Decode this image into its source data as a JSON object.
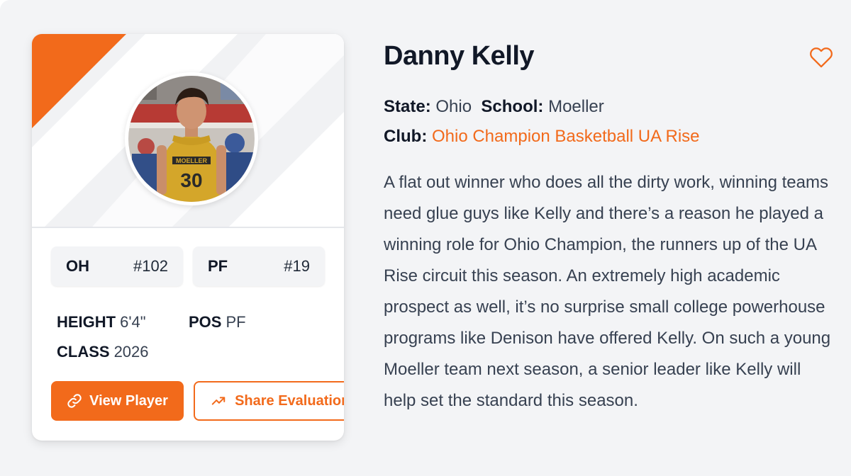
{
  "player": {
    "name": "Danny Kelly",
    "state_label": "State:",
    "state": "Ohio",
    "school_label": "School:",
    "school": "Moeller",
    "club_label": "Club:",
    "club": "Ohio Champion Basketball UA Rise",
    "description": "A flat out winner who does all the dirty work, winning teams need glue guys like Kelly and there’s a reason he played a winning role for Ohio Champion, the runners up of the UA Rise circuit this season. An extremely high academic prospect as well, it’s no surprise small college powerhouse programs like Denison have offered Kelly. On such a young Moeller team next season, a senior leader like Kelly will help set the standard this season."
  },
  "ranks": [
    {
      "key": "OH",
      "value": "#102"
    },
    {
      "key": "PF",
      "value": "#19"
    }
  ],
  "stats": {
    "height_label": "HEIGHT",
    "height": "6'4\"",
    "pos_label": "POS",
    "pos": "PF",
    "class_label": "CLASS",
    "class": "2026"
  },
  "jersey": {
    "team": "MOELLER",
    "number": "30"
  },
  "buttons": {
    "view_player": "View Player",
    "share_evaluation": "Share Evaluation"
  },
  "icons": {
    "favorite": "heart-icon",
    "view": "link-icon",
    "share": "trending-up-icon"
  },
  "colors": {
    "accent": "#f26a1b",
    "heading": "#111827",
    "text": "#374151",
    "background": "#f3f4f6"
  }
}
